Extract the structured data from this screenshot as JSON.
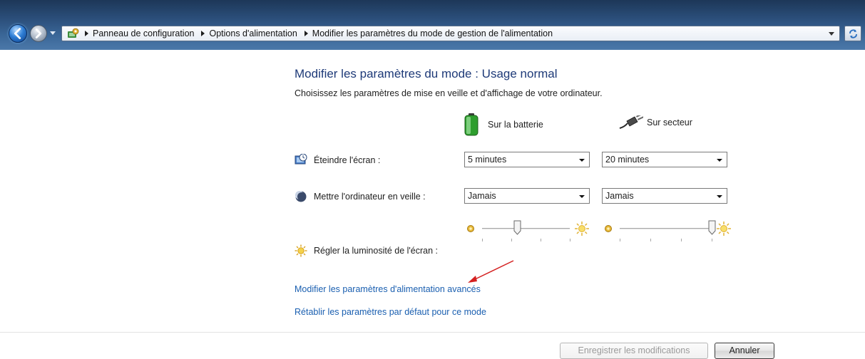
{
  "breadcrumb": {
    "items": [
      "Panneau de configuration",
      "Options d'alimentation",
      "Modifier les paramètres du mode de gestion de l'alimentation"
    ]
  },
  "content": {
    "title": "Modifier les paramètres du mode : Usage normal",
    "subtitle": "Choisissez les paramètres de mise en veille et d'affichage de votre ordinateur."
  },
  "columns": {
    "battery": "Sur la batterie",
    "plugged": "Sur secteur"
  },
  "settings": {
    "screen_off": {
      "label": "Éteindre l'écran :",
      "battery_value": "5 minutes",
      "plugged_value": "20 minutes"
    },
    "sleep": {
      "label": "Mettre l'ordinateur en veille :",
      "battery_value": "Jamais",
      "plugged_value": "Jamais"
    },
    "brightness": {
      "label": "Régler la luminosité de l'écran :",
      "battery_level": 0.4,
      "plugged_level": 1.0
    }
  },
  "links": {
    "advanced": "Modifier les paramètres d'alimentation avancés",
    "restore": "Rétablir les paramètres par défaut pour ce mode"
  },
  "buttons": {
    "save": "Enregistrer les modifications",
    "cancel": "Annuler"
  },
  "colors": {
    "title_text": "#1e3a78",
    "link": "#1a5fb0",
    "annotation_arrow": "#d42020"
  }
}
